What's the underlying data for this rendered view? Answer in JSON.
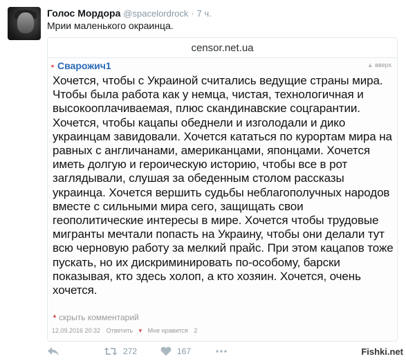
{
  "tweet": {
    "author": "Голос Мордора",
    "handle": "@spacelordrock",
    "separator": "·",
    "time": "7 ч.",
    "text": "Мрии маленького окраинца."
  },
  "card": {
    "site": "censor.net.ua",
    "comment": {
      "author": "Сварожич1",
      "up_label": "вверх",
      "body": "Хочется, чтобы с Украиной считались ведущие страны мира. Чтобы была работа как у немца, чистая, технологичная и высокооплачиваемая, плюс скандинавские соцгарантии. Хочется, чтобы кацапы обеднели и изголодали и дико украинцам завидовали. Хочется кататься по курортам мира на равных с англичанами, американцами, японцами. Хочется иметь долгую и героическую историю, чтобы все в рот заглядывали, слушая за обеденным столом рассказы украинца. Хочется вершить судьбы неблагополучных народов вместе с сильными мира сего, защищать свои геополитические интересы в мире. Хочется чтобы трудовые мигранты мечтали попасть на Украину, чтобы они делали тут всю черновую работу за мелкий прайс. При этом кацапов тоже пускать, но их дискриминировать по-особому, барски показывая, кто здесь холоп, а кто хозяин. Хочется, очень хочется.",
      "hide_label": "скрыть комментарий",
      "date": "12.09.2016 20:32",
      "reply_label": "Ответить",
      "dislike_mark": "▾",
      "like_label": "Мне нравится",
      "like_count": "2"
    }
  },
  "actions": {
    "retweets": "272",
    "likes": "167"
  },
  "watermark": "Fishki.net"
}
